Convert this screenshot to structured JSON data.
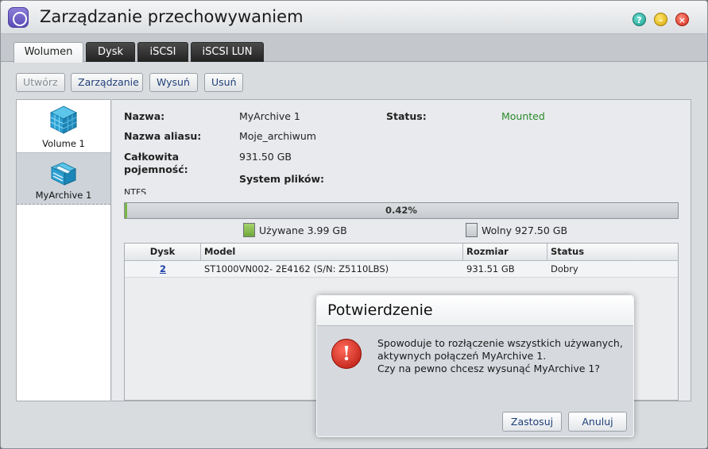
{
  "window": {
    "title": "Zarządzanie przechowywaniem",
    "controls": [
      "help-icon",
      "minimize-icon",
      "close-icon"
    ]
  },
  "tabs": [
    {
      "label": "Wolumen",
      "active": true
    },
    {
      "label": "Dysk",
      "active": false
    },
    {
      "label": "iSCSI",
      "active": false
    },
    {
      "label": "iSCSI LUN",
      "active": false
    }
  ],
  "toolbar": {
    "create": "Utwórz",
    "manage": "Zarządzanie",
    "eject": "Wysuń",
    "delete": "Usuń"
  },
  "volumes": [
    {
      "label": "Volume 1",
      "icon": "cube-icon"
    },
    {
      "label": "MyArchive 1",
      "icon": "archive-disk-icon",
      "selected": true
    }
  ],
  "details": {
    "name_label": "Nazwa:",
    "name_value": "MyArchive 1",
    "status_label": "Status:",
    "status_value": "Mounted",
    "alias_label": "Nazwa aliasu:",
    "alias_value": "Moje_archiwum",
    "capacity_label_1": "Całkowita",
    "capacity_label_2": "pojemność:",
    "capacity_value": "931.50 GB",
    "fs_label": "System plików:",
    "fs_value": "NTFS"
  },
  "usage": {
    "percent_text": "0.42%",
    "used_fraction": 0.0042,
    "used_text": "Używane 3.99 GB",
    "free_text": "Wolny 927.50 GB",
    "used_color": "#7ab648"
  },
  "disk_table": {
    "headers": [
      "Dysk",
      "Model",
      "Rozmiar",
      "Status"
    ],
    "rows": [
      {
        "disk": "2",
        "model": "ST1000VN002- 2E4162 (S/N: Z5110LBS)",
        "size": "931.51 GB",
        "status": "Dobry"
      }
    ]
  },
  "dialog": {
    "title": "Potwierdzenie",
    "line1": "Spowoduje to rozłączenie wszystkich używanych,",
    "line2": "aktywnych połączeń MyArchive 1.",
    "line3": "Czy na pewno chcesz wysunąć MyArchive 1?",
    "apply": "Zastosuj",
    "cancel": "Anuluj"
  }
}
